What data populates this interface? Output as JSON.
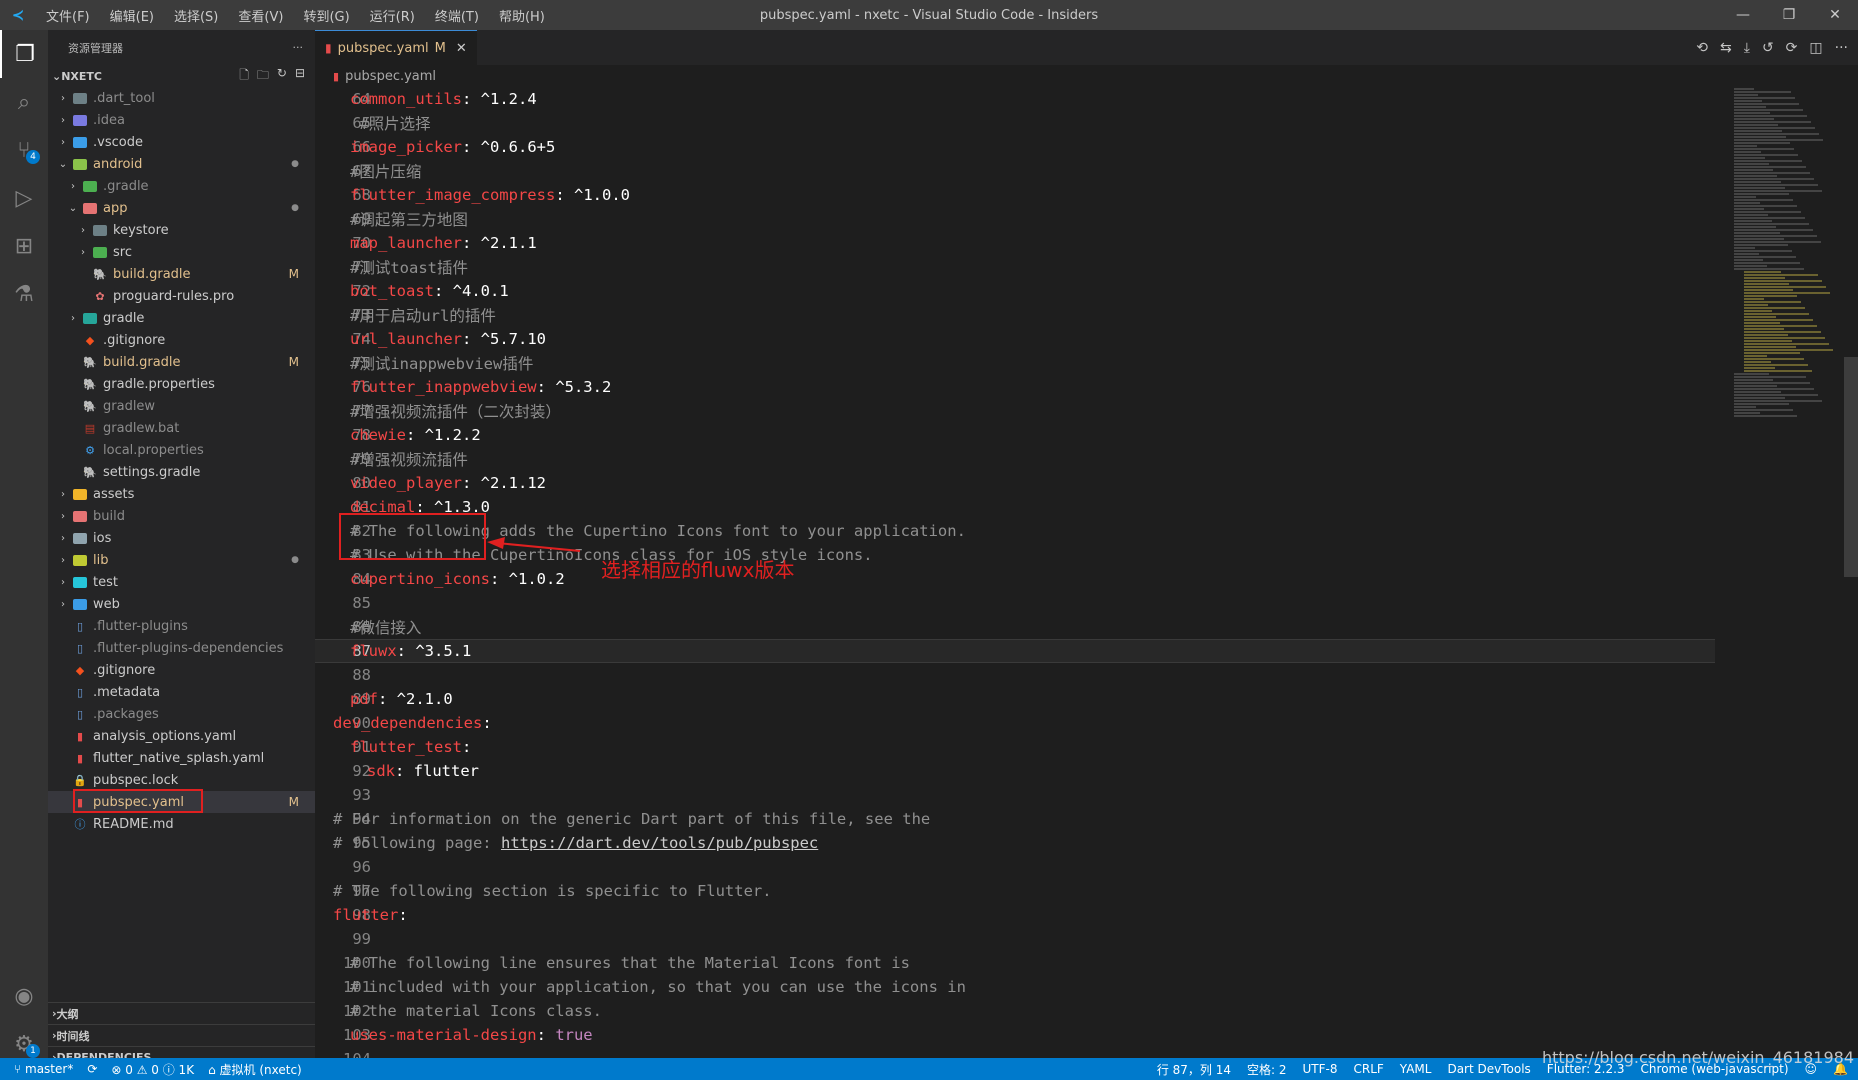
{
  "window": {
    "logo": "≺",
    "title": "pubspec.yaml - nxetc - Visual Studio Code - Insiders",
    "menus": [
      "文件(F)",
      "编辑(E)",
      "选择(S)",
      "查看(V)",
      "转到(G)",
      "运行(R)",
      "终端(T)",
      "帮助(H)"
    ]
  },
  "activitybar": {
    "scm_badge": "4",
    "settings_badge": "1"
  },
  "sidebar": {
    "title": "资源管理器",
    "more": "···",
    "root": "NXETC",
    "items": [
      {
        "label": ".dart_tool",
        "indent": 0,
        "type": "folder",
        "expanded": false,
        "color": "#6d8086",
        "label_class": "label-gray",
        "deco": ""
      },
      {
        "label": ".idea",
        "indent": 0,
        "type": "folder",
        "expanded": false,
        "color": "#7a7ae0",
        "label_class": "label-gray",
        "deco": ""
      },
      {
        "label": ".vscode",
        "indent": 0,
        "type": "folder",
        "expanded": false,
        "color": "#3b9de8",
        "label_class": "",
        "deco": ""
      },
      {
        "label": "android",
        "indent": 0,
        "type": "folder",
        "expanded": true,
        "color": "#8bc34a",
        "label_class": "label-modified",
        "deco": "dot"
      },
      {
        "label": ".gradle",
        "indent": 1,
        "type": "folder",
        "expanded": false,
        "color": "#4caf50",
        "label_class": "label-gray",
        "deco": ""
      },
      {
        "label": "app",
        "indent": 1,
        "type": "folder",
        "expanded": true,
        "color": "#e57373",
        "label_class": "label-modified",
        "deco": "dot"
      },
      {
        "label": "keystore",
        "indent": 2,
        "type": "folder",
        "expanded": false,
        "color": "#6d8086",
        "label_class": "",
        "deco": ""
      },
      {
        "label": "src",
        "indent": 2,
        "type": "folder",
        "expanded": false,
        "color": "#4caf50",
        "label_class": "",
        "deco": ""
      },
      {
        "label": "build.gradle",
        "indent": 2,
        "type": "file",
        "icon": "gradle",
        "label_class": "label-modified",
        "deco": "M"
      },
      {
        "label": "proguard-rules.pro",
        "indent": 2,
        "type": "file",
        "icon": "pro",
        "label_class": "",
        "deco": ""
      },
      {
        "label": "gradle",
        "indent": 1,
        "type": "folder",
        "expanded": false,
        "color": "#26a69a",
        "label_class": "",
        "deco": ""
      },
      {
        "label": ".gitignore",
        "indent": 1,
        "type": "file",
        "icon": "git",
        "label_class": "",
        "deco": ""
      },
      {
        "label": "build.gradle",
        "indent": 1,
        "type": "file",
        "icon": "gradle",
        "label_class": "label-modified",
        "deco": "M"
      },
      {
        "label": "gradle.properties",
        "indent": 1,
        "type": "file",
        "icon": "gradle",
        "label_class": "",
        "deco": ""
      },
      {
        "label": "gradlew",
        "indent": 1,
        "type": "file",
        "icon": "gradle",
        "label_class": "label-gray",
        "deco": ""
      },
      {
        "label": "gradlew.bat",
        "indent": 1,
        "type": "file",
        "icon": "bat",
        "label_class": "label-gray",
        "deco": ""
      },
      {
        "label": "local.properties",
        "indent": 1,
        "type": "file",
        "icon": "gear",
        "label_class": "label-gray",
        "deco": ""
      },
      {
        "label": "settings.gradle",
        "indent": 1,
        "type": "file",
        "icon": "gradle",
        "label_class": "",
        "deco": ""
      },
      {
        "label": "assets",
        "indent": 0,
        "type": "folder",
        "expanded": false,
        "color": "#f0b429",
        "label_class": "",
        "deco": ""
      },
      {
        "label": "build",
        "indent": 0,
        "type": "folder",
        "expanded": false,
        "color": "#e57373",
        "label_class": "label-gray",
        "deco": ""
      },
      {
        "label": "ios",
        "indent": 0,
        "type": "folder",
        "expanded": false,
        "color": "#90a4ae",
        "label_class": "",
        "deco": ""
      },
      {
        "label": "lib",
        "indent": 0,
        "type": "folder",
        "expanded": false,
        "color": "#c0ca33",
        "label_class": "label-modified",
        "deco": "dot"
      },
      {
        "label": "test",
        "indent": 0,
        "type": "folder",
        "expanded": false,
        "color": "#26c6da",
        "label_class": "",
        "deco": ""
      },
      {
        "label": "web",
        "indent": 0,
        "type": "folder",
        "expanded": false,
        "color": "#3b9de8",
        "label_class": "",
        "deco": ""
      },
      {
        "label": ".flutter-plugins",
        "indent": 0,
        "type": "file",
        "icon": "doc",
        "label_class": "label-gray",
        "deco": ""
      },
      {
        "label": ".flutter-plugins-dependencies",
        "indent": 0,
        "type": "file",
        "icon": "doc",
        "label_class": "label-gray",
        "deco": ""
      },
      {
        "label": ".gitignore",
        "indent": 0,
        "type": "file",
        "icon": "git",
        "label_class": "",
        "deco": ""
      },
      {
        "label": ".metadata",
        "indent": 0,
        "type": "file",
        "icon": "doc",
        "label_class": "",
        "deco": ""
      },
      {
        "label": ".packages",
        "indent": 0,
        "type": "file",
        "icon": "doc",
        "label_class": "label-gray",
        "deco": ""
      },
      {
        "label": "analysis_options.yaml",
        "indent": 0,
        "type": "file",
        "icon": "yaml",
        "label_class": "",
        "deco": ""
      },
      {
        "label": "flutter_native_splash.yaml",
        "indent": 0,
        "type": "file",
        "icon": "yaml",
        "label_class": "",
        "deco": ""
      },
      {
        "label": "pubspec.lock",
        "indent": 0,
        "type": "file",
        "icon": "lock",
        "label_class": "",
        "deco": ""
      },
      {
        "label": "pubspec.yaml",
        "indent": 0,
        "type": "file",
        "icon": "yaml",
        "label_class": "label-modified",
        "deco": "M",
        "selected": true
      },
      {
        "label": "README.md",
        "indent": 0,
        "type": "file",
        "icon": "info",
        "label_class": "",
        "deco": ""
      }
    ],
    "bottom_sections": [
      "大纲",
      "时间线",
      "DEPENDENCIES"
    ]
  },
  "editor": {
    "tab": {
      "label": "pubspec.yaml",
      "status": "M",
      "close": "✕"
    },
    "breadcrumb": "pubspec.yaml",
    "lines": [
      {
        "n": "64",
        "indent": 1,
        "key": "common_utils",
        "val": " ^1.2.4"
      },
      {
        "n": "65",
        "indent": 1,
        "comment": " #照片选择"
      },
      {
        "n": "66",
        "indent": 1,
        "key": "image_picker",
        "val": " ^0.6.6+5"
      },
      {
        "n": "67",
        "indent": 1,
        "comment": "#图片压缩"
      },
      {
        "n": "68",
        "indent": 1,
        "key": "flutter_image_compress",
        "val": " ^1.0.0"
      },
      {
        "n": "69",
        "indent": 1,
        "comment": "#调起第三方地图"
      },
      {
        "n": "70",
        "indent": 1,
        "key": "map_launcher",
        "val": " ^2.1.1"
      },
      {
        "n": "71",
        "indent": 1,
        "comment": "#测试toast插件"
      },
      {
        "n": "72",
        "indent": 1,
        "key": "bot_toast",
        "val": " ^4.0.1"
      },
      {
        "n": "73",
        "indent": 1,
        "comment": "#用于启动url的插件"
      },
      {
        "n": "74",
        "indent": 1,
        "key": "url_launcher",
        "val": " ^5.7.10"
      },
      {
        "n": "75",
        "indent": 1,
        "comment": "#测试inappwebview插件"
      },
      {
        "n": "76",
        "indent": 1,
        "key": "flutter_inappwebview",
        "val": " ^5.3.2"
      },
      {
        "n": "77",
        "indent": 1,
        "comment": "#增强视频流插件（二次封装）"
      },
      {
        "n": "78",
        "indent": 1,
        "key": "chewie",
        "val": " ^1.2.2"
      },
      {
        "n": "79",
        "indent": 1,
        "comment": "#增强视频流插件"
      },
      {
        "n": "80",
        "indent": 1,
        "key": "video_player",
        "val": " ^2.1.12"
      },
      {
        "n": "81",
        "indent": 1,
        "key": "decimal",
        "val": " ^1.3.0"
      },
      {
        "n": "82",
        "indent": 1,
        "comment": "# The following adds the Cupertino Icons font to your application."
      },
      {
        "n": "83",
        "indent": 1,
        "comment": "# Use with the CupertinoIcons class for iOS style icons."
      },
      {
        "n": "84",
        "indent": 1,
        "key": "cupertino_icons",
        "val": " ^1.0.2"
      },
      {
        "n": "85",
        "indent": 0
      },
      {
        "n": "86",
        "indent": 1,
        "comment": "#微信接入"
      },
      {
        "n": "87",
        "indent": 1,
        "key": "fluwx",
        "val": " ^3.5.1",
        "current": true
      },
      {
        "n": "88",
        "indent": 0
      },
      {
        "n": "89",
        "indent": 1,
        "key": "pdf",
        "val": " ^2.1.0"
      },
      {
        "n": "90",
        "indent": 0,
        "key": "dev_dependencies",
        "val": ""
      },
      {
        "n": "91",
        "indent": 1,
        "key": "flutter_test",
        "val": ""
      },
      {
        "n": "92",
        "indent": 2,
        "key": "sdk",
        "val": " flutter"
      },
      {
        "n": "93",
        "indent": 0
      },
      {
        "n": "94",
        "indent": 0,
        "comment": "# For information on the generic Dart part of this file, see the"
      },
      {
        "n": "95",
        "indent": 0,
        "comment": "# following page: ",
        "url": "https://dart.dev/tools/pub/pubspec"
      },
      {
        "n": "96",
        "indent": 0
      },
      {
        "n": "97",
        "indent": 0,
        "comment": "# The following section is specific to Flutter."
      },
      {
        "n": "98",
        "indent": 0,
        "key": "flutter",
        "val": ""
      },
      {
        "n": "99",
        "indent": 0
      },
      {
        "n": "100",
        "indent": 1,
        "comment": "# The following line ensures that the Material Icons font is"
      },
      {
        "n": "101",
        "indent": 1,
        "comment": "# included with your application, so that you can use the icons in"
      },
      {
        "n": "102",
        "indent": 1,
        "comment": "# the material Icons class."
      },
      {
        "n": "103",
        "indent": 1,
        "key": "uses-material-design",
        "val": " true",
        "bool": true
      },
      {
        "n": "104",
        "indent": 0
      }
    ],
    "annotation": "选择相应的fluwx版本"
  },
  "statusbar": {
    "branch": "master*",
    "sync": "⟳",
    "problems": "⊗ 0 ⚠ 0 ⓘ 1K",
    "vm": "虚拟机 (nxetc)",
    "position": "行 87，列 14",
    "spaces": "空格: 2",
    "encoding": "UTF-8",
    "eol": "CRLF",
    "language": "YAML",
    "devtools": "Dart DevTools",
    "flutter": "Flutter: 2.2.3",
    "device": "Chrome (web-javascript)"
  },
  "watermark": "https://blog.csdn.net/weixin_46181984"
}
